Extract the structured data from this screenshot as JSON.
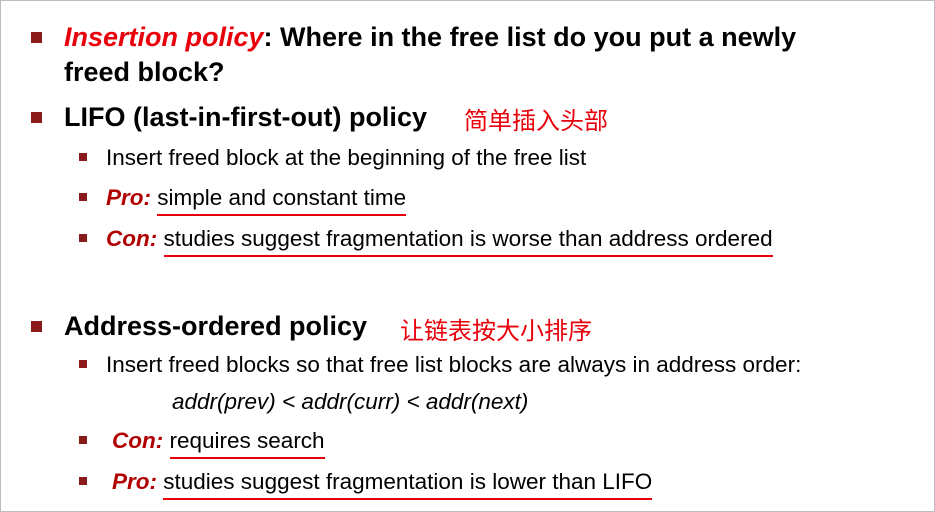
{
  "slide": {
    "insertion": {
      "term": "Insertion policy",
      "colon": ":",
      "text_line1": " Where in the free list do you put a newly",
      "text_line2": "freed block?"
    },
    "lifo": {
      "title": "LIFO (last-in-first-out) policy",
      "note": "简单插入头部",
      "items": [
        {
          "text": "Insert freed block at the beginning of the free list"
        },
        {
          "label": "Pro:",
          "text": "simple and constant time"
        },
        {
          "label": "Con:",
          "text": "studies suggest fragmentation is worse than address ordered"
        }
      ]
    },
    "address": {
      "title": "Address-ordered policy",
      "note": "让链表按大小排序",
      "items": [
        {
          "text": "Insert freed blocks so that free list blocks are always in address order:"
        },
        {
          "formula": "addr(prev) < addr(curr) < addr(next)"
        },
        {
          "label": "Con:",
          "text": "requires search"
        },
        {
          "label": "Pro:",
          "text": "studies suggest fragmentation is lower than LIFO"
        }
      ]
    },
    "colors": {
      "bullet": "#8b1a1a",
      "accent_red": "#e8000b",
      "label_red": "#b00000"
    }
  }
}
